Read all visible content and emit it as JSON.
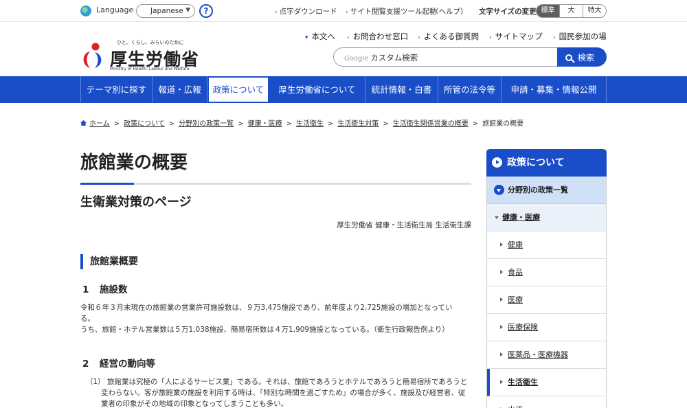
{
  "topbar": {
    "language_label": "Language",
    "language_value": "Japanese",
    "help_label": "?",
    "links": [
      "点字ダウンロード",
      "サイト閲覧支援ツール起動",
      "（ヘルプ）"
    ],
    "font_size_label": "文字サイズの変更",
    "font_sizes": [
      "標準",
      "大",
      "特大"
    ]
  },
  "header": {
    "logo_tagline": "ひと、くらし、みらいのために",
    "logo_name": "厚生労働省",
    "logo_english": "Ministry of Health, Labour and Welfare",
    "links": [
      "本文へ",
      "お問合わせ窓口",
      "よくある御質問",
      "サイトマップ",
      "国民参加の場"
    ],
    "search_brand": "Google",
    "search_placeholder": "カスタム検索",
    "search_button": "検索"
  },
  "gnav": [
    "テーマ別に探す",
    "報道・広報",
    "政策について",
    "厚生労働省について",
    "統計情報・白書",
    "所管の法令等",
    "申請・募集・情報公開"
  ],
  "breadcrumb": [
    "ホーム",
    "政策について",
    "分野別の政策一覧",
    "健康・医療",
    "生活衛生",
    "生活衛生対策",
    "生活衛生関係営業の概要",
    "旅館業の概要"
  ],
  "main": {
    "title": "旅館業の概要",
    "subtitle": "生衛業対策のページ",
    "org": "厚生労働省 健康・生活衛生局 生活衛生課",
    "section_title": "旅館業概要",
    "s1_num": "1",
    "s1_title": "施設数",
    "s1_line1": "令和６年３月末現在の旅館業の営業許可施設数は、９万3,475施設であり、前年度より2,725施設の増加となってい",
    "s1_line2": "る。",
    "s1_line3": "うち、旅館・ホテル営業数は５万1,038施設、簡易宿所数は４万1,909施設となっている。（衛生行政報告例より）",
    "s2_num": "2",
    "s2_title": "経営の動向等",
    "s2_item1": "（1） 旅館業は究極の「人によるサービス業」である。それは、旅館であろうとホテルであろうと簡易宿所であろうと変わらない。客が旅館業の施設を利用する時は、「特別な時間を過ごすため」の場合が多く、施設及び経営者、従業者の印象がその地域の印象となってしまうことも多い。"
  },
  "sidenav": {
    "header": "政策について",
    "sub": "分野別の政策一覧",
    "sub2": "健康・医療",
    "items": [
      "健康",
      "食品",
      "医療",
      "医療保険",
      "医薬品・医療機器",
      "生活衛生",
      "水道"
    ],
    "active_item": "生活衛生"
  },
  "colors": {
    "brand_blue": "#1a4ec9",
    "side_sub_bg": "#cfe0f7"
  }
}
